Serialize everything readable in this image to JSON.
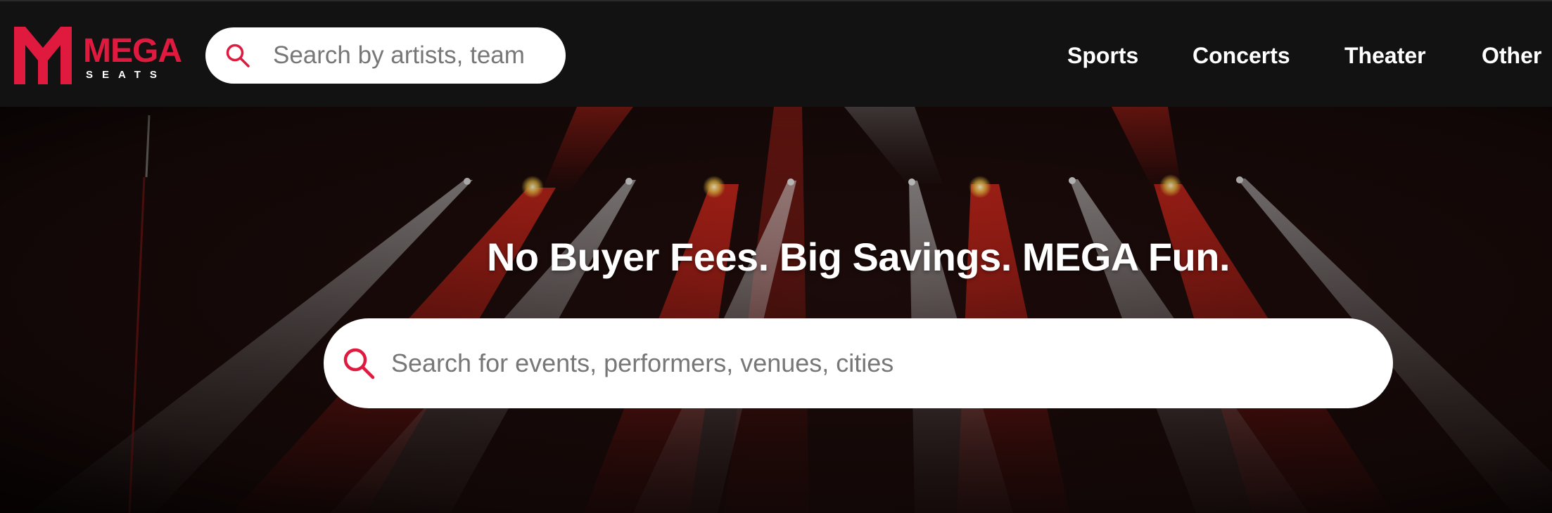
{
  "brand": {
    "name": "MEGA",
    "sub": "SEATS",
    "color": "#e0193f"
  },
  "header": {
    "search_placeholder": "Search by artists, team",
    "nav": [
      "Sports",
      "Concerts",
      "Theater",
      "Other"
    ]
  },
  "hero": {
    "title": "No Buyer Fees. Big Savings. MEGA Fun.",
    "search_placeholder": "Search for events, performers, venues, cities"
  },
  "icons": {
    "search": "search-icon"
  }
}
